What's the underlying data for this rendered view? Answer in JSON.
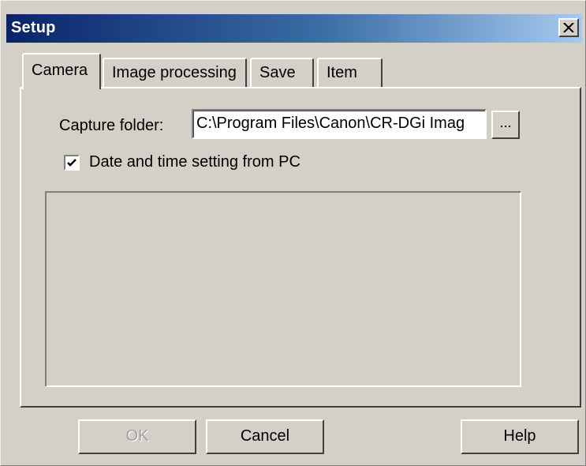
{
  "window": {
    "title": "Setup",
    "close_label": "×"
  },
  "tabs": [
    {
      "label": "Camera",
      "active": true
    },
    {
      "label": "Image processing",
      "active": false
    },
    {
      "label": "Save",
      "active": false
    },
    {
      "label": "Item",
      "active": false
    }
  ],
  "camera_tab": {
    "capture_folder_label": "Capture folder:",
    "capture_folder_value": "C:\\Program Files\\Canon\\CR-DGi Imag",
    "browse_label": "...",
    "date_time_checkbox": {
      "label": "Date and time setting from PC",
      "checked": true
    }
  },
  "buttons": {
    "ok": {
      "label": "OK",
      "enabled": false
    },
    "cancel": {
      "label": "Cancel",
      "enabled": true
    },
    "help": {
      "label": "Help",
      "enabled": true
    }
  },
  "colors": {
    "title_gradient_start": "#0a246a",
    "title_gradient_end": "#a6caf0",
    "face": "#d4d0c8"
  },
  "icons": {
    "close": "close-icon",
    "check": "checkmark-icon"
  }
}
